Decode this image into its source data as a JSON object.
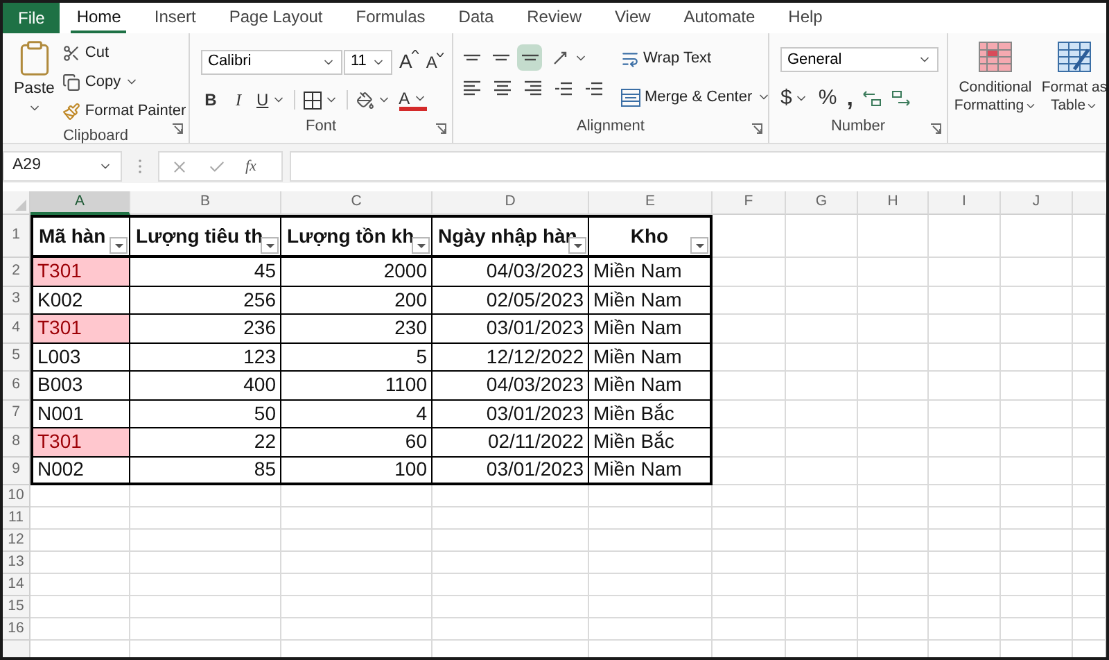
{
  "ribbon_tabs": [
    {
      "label": "File",
      "kind": "file",
      "selected": false
    },
    {
      "label": "Home",
      "kind": "tab",
      "selected": true
    },
    {
      "label": "Insert",
      "kind": "tab",
      "selected": false
    },
    {
      "label": "Page Layout",
      "kind": "tab",
      "selected": false
    },
    {
      "label": "Formulas",
      "kind": "tab",
      "selected": false
    },
    {
      "label": "Data",
      "kind": "tab",
      "selected": false
    },
    {
      "label": "Review",
      "kind": "tab",
      "selected": false
    },
    {
      "label": "View",
      "kind": "tab",
      "selected": false
    },
    {
      "label": "Automate",
      "kind": "tab",
      "selected": false
    },
    {
      "label": "Help",
      "kind": "tab",
      "selected": false
    }
  ],
  "clipboard": {
    "label": "Clipboard",
    "paste": "Paste",
    "cut": "Cut",
    "copy": "Copy",
    "format_painter": "Format Painter"
  },
  "font": {
    "label": "Font",
    "font_name": "Calibri",
    "font_size": "11",
    "grow": "A",
    "shrink": "A",
    "bold": "B",
    "italic": "I",
    "underline": "U",
    "font_color": "A"
  },
  "alignment": {
    "label": "Alignment",
    "vertical_buttons": [
      {
        "selected": false
      },
      {
        "selected": false
      },
      {
        "selected": true
      }
    ],
    "wrap_text": "Wrap Text",
    "merge_center": "Merge & Center"
  },
  "number": {
    "label": "Number",
    "format": "General",
    "currency": "$",
    "percent": "%",
    "comma": ","
  },
  "styles": {
    "conditional_formatting": "Conditional Formatting",
    "format_as_table": "Format as Table"
  },
  "formula_bar": {
    "name_box": "A29",
    "function": "fx"
  },
  "columns": [
    {
      "letter": "A",
      "selected": true
    },
    {
      "letter": "B",
      "selected": false
    },
    {
      "letter": "C",
      "selected": false
    },
    {
      "letter": "D",
      "selected": false
    },
    {
      "letter": "E",
      "selected": false
    },
    {
      "letter": "F",
      "selected": false
    },
    {
      "letter": "G",
      "selected": false
    },
    {
      "letter": "H",
      "selected": false
    },
    {
      "letter": "I",
      "selected": false
    },
    {
      "letter": "J",
      "selected": false
    }
  ],
  "sheet": {
    "header_row": {
      "number": "1",
      "headers": [
        "Mã hàn",
        "Lượng tiêu th",
        "Lượng tồn kh",
        "Ngày nhập hàn",
        "Kho"
      ]
    },
    "rows": [
      {
        "number": "2",
        "code": "T301",
        "highlighted": true,
        "sold": "45",
        "stock": "2000",
        "date": "04/03/2023",
        "warehouse": "Miền Nam"
      },
      {
        "number": "3",
        "code": "K002",
        "highlighted": false,
        "sold": "256",
        "stock": "200",
        "date": "02/05/2023",
        "warehouse": "Miền Nam"
      },
      {
        "number": "4",
        "code": "T301",
        "highlighted": true,
        "sold": "236",
        "stock": "230",
        "date": "03/01/2023",
        "warehouse": "Miền Nam"
      },
      {
        "number": "5",
        "code": "L003",
        "highlighted": false,
        "sold": "123",
        "stock": "5",
        "date": "12/12/2022",
        "warehouse": "Miền Nam"
      },
      {
        "number": "6",
        "code": "B003",
        "highlighted": false,
        "sold": "400",
        "stock": "1100",
        "date": "04/03/2023",
        "warehouse": "Miền Nam"
      },
      {
        "number": "7",
        "code": "N001",
        "highlighted": false,
        "sold": "50",
        "stock": "4",
        "date": "03/01/2023",
        "warehouse": "Miền Bắc"
      },
      {
        "number": "8",
        "code": "T301",
        "highlighted": true,
        "sold": "22",
        "stock": "60",
        "date": "02/11/2022",
        "warehouse": "Miền Bắc"
      },
      {
        "number": "9",
        "code": "N002",
        "highlighted": false,
        "sold": "85",
        "stock": "100",
        "date": "03/01/2023",
        "warehouse": "Miền Nam"
      }
    ],
    "empty_rows": [
      "10",
      "11",
      "12",
      "13",
      "14",
      "15",
      "16"
    ]
  }
}
